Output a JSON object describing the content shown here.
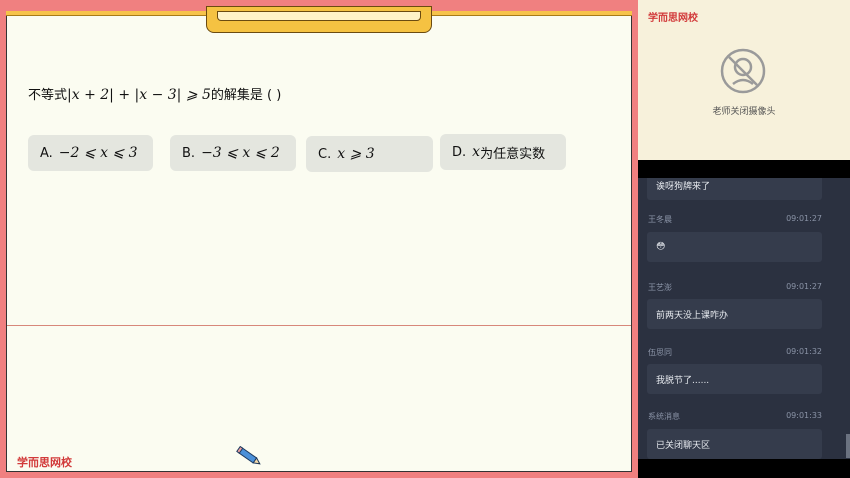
{
  "board": {
    "question_prefix": "不等式",
    "question_math": "|x + 2| + |x − 3| ⩾ 5",
    "question_suffix": "的解集是 (      )",
    "options": [
      {
        "letter": "A.",
        "math": "−2 ⩽ x ⩽ 3",
        "text": ""
      },
      {
        "letter": "B.",
        "math": "−3 ⩽ x ⩽ 2",
        "text": ""
      },
      {
        "letter": "C.",
        "math": "x ⩾ 3",
        "text": ""
      },
      {
        "letter": "D.",
        "math": "x",
        "text": "为任意实数"
      }
    ],
    "logo": "学而思网校"
  },
  "sidebar": {
    "logo": "学而思网校",
    "camera_status": "老师关闭摄像头"
  },
  "chat": {
    "messages": [
      {
        "name": "",
        "time": "",
        "text": "诶呀狗牌来了"
      },
      {
        "name": "王冬晨",
        "time": "09:01:27",
        "text": "😳"
      },
      {
        "name": "王艺澎",
        "time": "09:01:27",
        "text": "前两天没上课咋办"
      },
      {
        "name": "伍思同",
        "time": "09:01:32",
        "text": "我脱节了......"
      },
      {
        "name": "系统消息",
        "time": "09:01:33",
        "text": "已关闭聊天区"
      }
    ]
  },
  "colors": {
    "accent": "#d23a3a",
    "frame": "#f08080",
    "chat_bg": "#2b3140"
  },
  "icons": [
    "camera-off-icon",
    "pencil-icon"
  ]
}
